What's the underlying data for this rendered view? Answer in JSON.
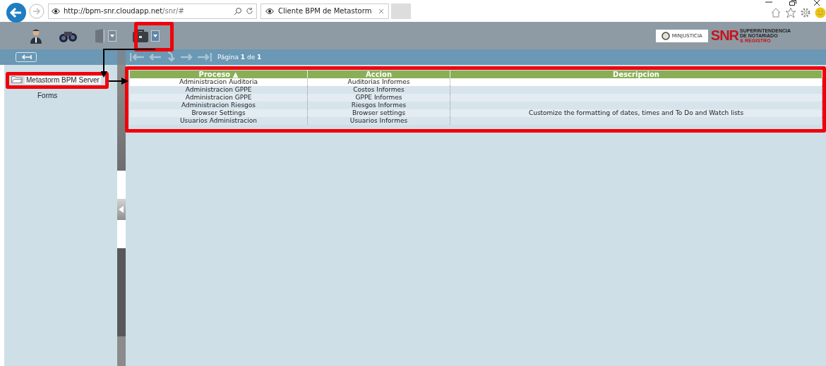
{
  "browser": {
    "url_host": "http://bpm-snr.cloudapp.net",
    "url_path": "/snr/#",
    "tab_title": "Cliente BPM de Metastorm"
  },
  "toolbar": [
    {
      "kind": "user",
      "dropdown": false
    },
    {
      "kind": "binoculars",
      "dropdown": false
    },
    {
      "kind": "document",
      "dropdown": true
    },
    {
      "kind": "briefcase",
      "dropdown": true
    }
  ],
  "logos": {
    "minjusticia": "MINJUSTICIA",
    "snr": "SNR",
    "snr_lines": [
      "SUPERINTENDENCIA",
      "DE NOTARIADO",
      "& REGISTRO"
    ]
  },
  "pager": {
    "label": "Página **1** de **1**"
  },
  "tree": [
    {
      "label": "Metastorm BPM Server",
      "selected": true,
      "expanded": true,
      "children": [
        {
          "label": "Forms",
          "selected": false
        }
      ]
    }
  ],
  "table": {
    "columns": [
      {
        "label": "Proceso",
        "sort_indicator": "▲"
      },
      {
        "label": "Accion"
      },
      {
        "label": "Descripcion"
      }
    ],
    "rows": [
      {
        "cells": [
          "Administracion Auditoria",
          "Auditorias Informes",
          ""
        ],
        "selected": true
      },
      {
        "cells": [
          "Administracion GPPE",
          "Costos Informes",
          ""
        ],
        "selected": false
      },
      {
        "cells": [
          "Administracion GPPE",
          "GPPE Informes",
          ""
        ],
        "selected": false
      },
      {
        "cells": [
          "Administracion Riesgos",
          "Riesgos Informes",
          ""
        ],
        "selected": false
      },
      {
        "cells": [
          "Browser Settings",
          "Browser settings",
          "Customize the formatting of dates, times and To Do and Watch lists"
        ],
        "selected": false
      },
      {
        "cells": [
          "Usuarios Administracion",
          "Usuarios Informes",
          ""
        ],
        "selected": false
      }
    ]
  }
}
